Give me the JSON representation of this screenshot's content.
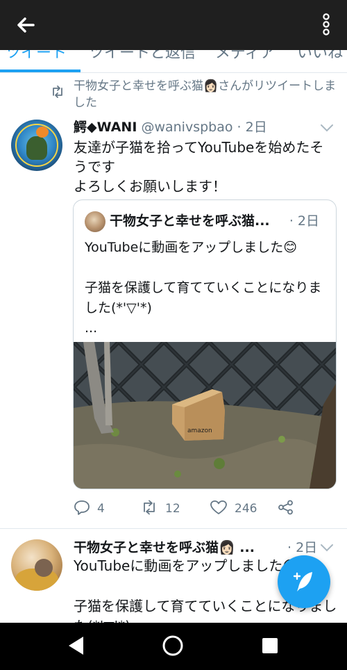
{
  "topbar": {
    "back_icon": "arrow-left-icon",
    "more_icon": "more-vertical-icon",
    "background": "#1f1f1f"
  },
  "tabs": [
    {
      "label": "ツイート",
      "active": true
    },
    {
      "label": "ツイートと返信",
      "active": false
    },
    {
      "label": "メディア",
      "active": false
    },
    {
      "label": "いいね",
      "active": false
    }
  ],
  "retweet_context": {
    "icon": "retweet-icon",
    "text": "干物女子と幸せを呼ぶ猫👩🏻󠄀さんがリツイートしました"
  },
  "tweet": {
    "name": "鰐◆WANI",
    "handle": "@wanivspbao",
    "time": "· 2日",
    "text": "友達が子猫を拾ってYouTubeを始めたそうです\nよろしくお願いします！",
    "quote": {
      "name": "干物女子と幸せを呼ぶ猫...",
      "time": "· 2日",
      "text": "YouTubeに動画をアップしました😊\n\n子猫を保護して育てていくことになりました(*'▽'*)\n...",
      "box_label": "amazon"
    },
    "actions": {
      "reply": {
        "icon": "reply-icon",
        "count": "4"
      },
      "retweet": {
        "icon": "retweet-icon",
        "count": "12"
      },
      "like": {
        "icon": "heart-icon",
        "count": "246"
      },
      "share": {
        "icon": "share-icon"
      }
    }
  },
  "tweet2": {
    "name": "干物女子と幸せを呼ぶ猫👩🏻󠄀 ...",
    "time": "· 2日",
    "text": "YouTubeに動画をアップしました😊\n\n子猫を保護して育てていくことになりました(*'▽'*)"
  },
  "fab": {
    "icon": "compose-tweet-icon",
    "color": "#1da1f2"
  },
  "navbar": {
    "back_icon": "nav-back-icon",
    "home_icon": "nav-home-icon",
    "recent_icon": "nav-recent-icon"
  }
}
